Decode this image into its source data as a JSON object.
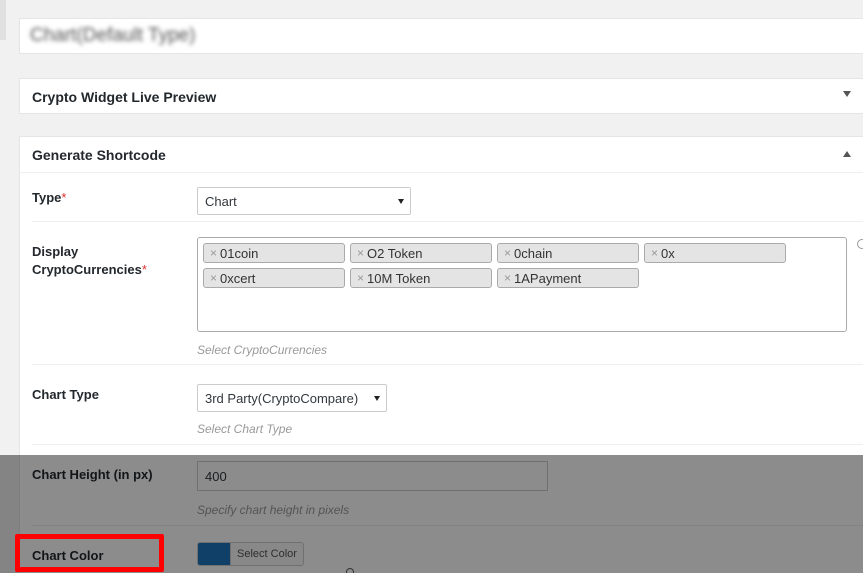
{
  "title_box": {
    "text": "Chart(Default Type)"
  },
  "live_preview": {
    "title": "Crypto Widget Live Preview"
  },
  "shortcode": {
    "title": "Generate Shortcode",
    "type": {
      "label": "Type",
      "required_mark": "*",
      "value": "Chart"
    },
    "currencies": {
      "label_line1": "Display",
      "label_line2": "CryptoCurrencies",
      "required_mark": "*",
      "remove_glyph": "×",
      "tags": [
        "01coin",
        "O2 Token",
        "0chain",
        "0x",
        "0xcert",
        "10M Token",
        "1APayment"
      ],
      "description": "Select CryptoCurrencies"
    },
    "chart_type": {
      "label": "Chart Type",
      "value": "3rd Party(CryptoCompare)",
      "description": "Select Chart Type"
    },
    "chart_height": {
      "label": "Chart Height (in px)",
      "value": "400",
      "description": "Specify chart height in pixels"
    },
    "chart_color": {
      "label": "Chart Color",
      "button_label": "Select Color",
      "swatch_color": "#1e73be"
    }
  },
  "colors": {
    "highlight": "#ff0000",
    "required": "#dc3232"
  }
}
